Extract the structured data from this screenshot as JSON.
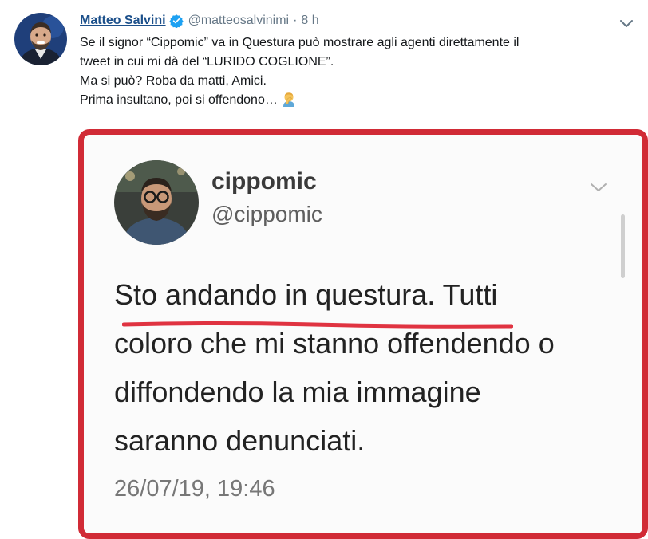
{
  "tweet": {
    "author": "Matteo Salvini",
    "handle": "@matteosalvinimi",
    "separator": "·",
    "time": "8 h",
    "text_lines": [
      "Se il signor “Cippomic” va in Questura può mostrare agli agenti direttamente il",
      "tweet in cui mi dà del “LURIDO COGLIONE”.",
      "Ma si può? Roba da matti, Amici.",
      "Prima insultano, poi si offendono…"
    ],
    "emoji_icon": "man-facepalming-emoji",
    "verified_icon": "verified-badge-icon",
    "menu_icon": "chevron-down-icon"
  },
  "media": {
    "border_color": "#d12b36",
    "inner_tweet": {
      "name": "cippomic",
      "handle": "@cippomic",
      "text_lines": [
        "Sto andando in questura. Tutti",
        "coloro che mi stanno offendendo o",
        "diffondendo la mia immagine",
        "saranno denunciati."
      ],
      "date": "26/07/19, 19:46",
      "annotation": "red-underline",
      "annotation_color": "#e03341"
    }
  },
  "colors": {
    "link": "#1b4f8a",
    "secondary": "#657786",
    "verified": "#1da1f2"
  }
}
